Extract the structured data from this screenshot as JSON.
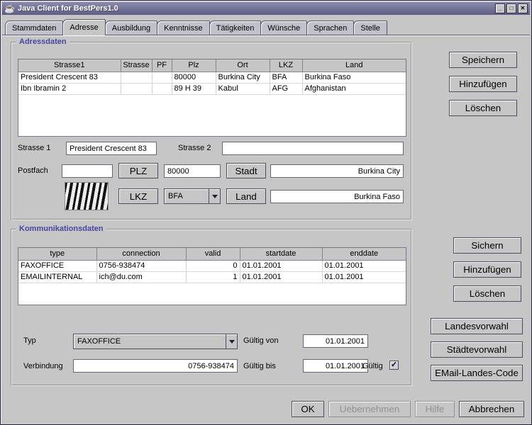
{
  "window": {
    "title": "Java Client for BestPers1.0",
    "icon_glyph": "☕",
    "controls": {
      "minimize": "_",
      "maximize": "□",
      "close": "✕"
    }
  },
  "tabs": [
    {
      "label": "Stammdaten"
    },
    {
      "label": "Adresse"
    },
    {
      "label": "Ausbildung"
    },
    {
      "label": "Kenntnisse"
    },
    {
      "label": "Tätigkeiten"
    },
    {
      "label": "Wünsche"
    },
    {
      "label": "Sprachen"
    },
    {
      "label": "Stelle"
    }
  ],
  "selected_tab": "Adresse",
  "adressdaten": {
    "title": "Adressdaten",
    "table": {
      "headers": [
        "Strasse1",
        "Strasse",
        "PF",
        "Plz",
        "Ort",
        "LKZ",
        "Land"
      ],
      "rows": [
        [
          "President Crescent 83",
          "",
          "",
          "80000",
          "Burkina City",
          "BFA",
          "Burkina Faso"
        ],
        [
          "Ibn Ibramin 2",
          "",
          "",
          "89 H 39",
          "Kabul",
          "AFG",
          "Afghanistan"
        ]
      ]
    },
    "form": {
      "strasse1_label": "Strasse 1",
      "strasse1_value": "President Crescent 83",
      "strasse2_label": "Strasse 2",
      "strasse2_value": "",
      "postfach_label": "Postfach",
      "postfach_value": "",
      "plz_button": "PLZ",
      "plz_value": "80000",
      "stadt_button": "Stadt",
      "stadt_value": "Burkina City",
      "lkz_button": "LKZ",
      "lkz_value": "BFA",
      "land_button": "Land",
      "land_value": "Burkina Faso"
    },
    "buttons": [
      "Speichern",
      "Hinzufügen",
      "Löschen"
    ]
  },
  "kommunikationsdaten": {
    "title": "Kommunikationsdaten",
    "table": {
      "headers": [
        "type",
        "connection",
        "valid",
        "startdate",
        "enddate"
      ],
      "rows": [
        [
          "FAXOFFICE",
          "0756-938474",
          "0",
          "01.01.2001",
          "01.01.2001"
        ],
        [
          "EMAILINTERNAL",
          "ich@du.com",
          "1",
          "01.01.2001",
          "01.01.2001"
        ]
      ]
    },
    "form": {
      "typ_label": "Typ",
      "typ_value": "FAXOFFICE",
      "gueltig_von_label": "Gültig von",
      "gueltig_von_value": "01.01.2001",
      "verbindung_label": "Verbindung",
      "verbindung_value": "0756-938474",
      "gueltig_bis_label": "Gültig bis",
      "gueltig_bis_value": "01.01.2001",
      "gueltig_label": "Gültig",
      "gueltig_checked": true,
      "check_glyph": "✓"
    },
    "buttons": [
      "Sichern",
      "Hinzufügen",
      "Löschen"
    ]
  },
  "vorwahl_buttons": [
    "Landesvorwahl",
    "Städtevorwahl",
    "EMail-Landes-Code"
  ],
  "bottom_buttons": [
    {
      "label": "OK",
      "enabled": true
    },
    {
      "label": "Uebernehmen",
      "enabled": false
    },
    {
      "label": "Hilfe",
      "enabled": false
    },
    {
      "label": "Abbrechen",
      "enabled": true
    }
  ],
  "colors": {
    "background": "#c6c6c6",
    "titlebar_top": "#8a8aad",
    "titlebar_bottom": "#5d5d85",
    "group_title": "#4646a0",
    "table_grid": "#d2d2d2"
  }
}
